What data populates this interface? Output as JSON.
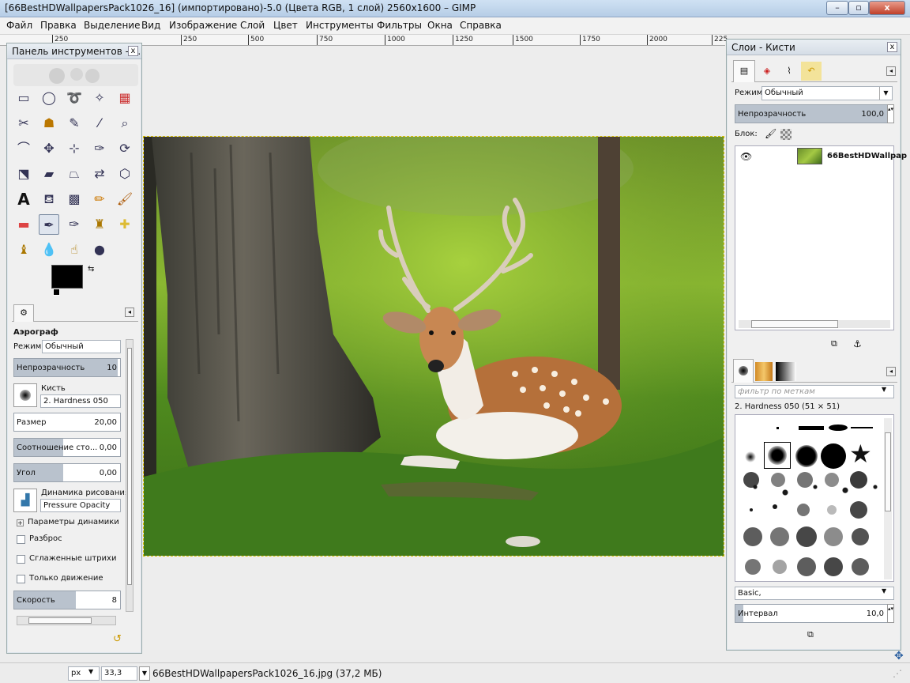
{
  "window": {
    "title": "[66BestHDWallpapersPack1026_16] (импортировано)-5.0 (Цвета RGB, 1 слой) 2560x1600 – GIMP",
    "min": "–",
    "max": "▫",
    "close": "x"
  },
  "menu": [
    "Файл",
    "Правка",
    "Выделение",
    "Вид",
    "Изображение",
    "Слой",
    "Цвет",
    "Инструменты",
    "Фильтры",
    "Окна",
    "Справка"
  ],
  "ruler": {
    "ticks": [
      "250",
      "",
      "250",
      "500",
      "750",
      "1000",
      "1250",
      "1500",
      "1750",
      "2000",
      "225"
    ]
  },
  "toolbox": {
    "title": "Панель инструментов - ...",
    "close": "x",
    "tools": [
      "rect-select",
      "ellipse-select",
      "lasso",
      "fuzzy-select",
      "color-select",
      "scissors",
      "foreground-select",
      "paths",
      "color-picker",
      "zoom",
      "measure",
      "move",
      "align",
      "crop",
      "rotate",
      "scale",
      "shear",
      "perspective",
      "flip",
      "cage",
      "text",
      "bucket-fill",
      "blend",
      "pencil",
      "paintbrush",
      "eraser",
      "airbrush",
      "ink",
      "clone",
      "heal",
      "perspective-clone",
      "blur",
      "smudge",
      "dodge"
    ],
    "fg_color": "#000000",
    "bg_color": "#ffffff"
  },
  "tool_options": {
    "title": "Аэрограф",
    "mode_label": "Режим:",
    "mode_value": "Обычный",
    "opacity_label": "Непрозрачность",
    "opacity_value": "10",
    "brush_label": "Кисть",
    "brush_value": "2. Hardness 050",
    "size_label": "Размер",
    "size_value": "20,00",
    "ratio_label": "Соотношение сто...",
    "ratio_value": "0,00",
    "angle_label": "Угол",
    "angle_value": "0,00",
    "dynamics_label": "Динамика рисования",
    "dynamics_value": "Pressure Opacity",
    "dyn_params": "Параметры динамики",
    "scatter": "Разброс",
    "smooth": "Сглаженные штрихи",
    "motion": "Только движение",
    "speed_label": "Скорость",
    "speed_value": "8"
  },
  "layers": {
    "title": "Слои - Кисти",
    "close": "x",
    "mode_label": "Режим:",
    "mode_value": "Обычный",
    "opacity_label": "Непрозрачность",
    "opacity_value": "100,0",
    "lock_label": "Блок:",
    "layer_name": "66BestHDWallpap"
  },
  "brushes": {
    "filter_placeholder": "фильтр по меткам",
    "current": "2. Hardness 050 (51 × 51)",
    "preset": "Basic,",
    "spacing_label": "Интервал",
    "spacing_value": "10,0"
  },
  "status": {
    "unit": "px",
    "zoom": "33,3",
    "file_info": "66BestHDWallpapersPack1026_16.jpg (37,2 МБ)"
  }
}
